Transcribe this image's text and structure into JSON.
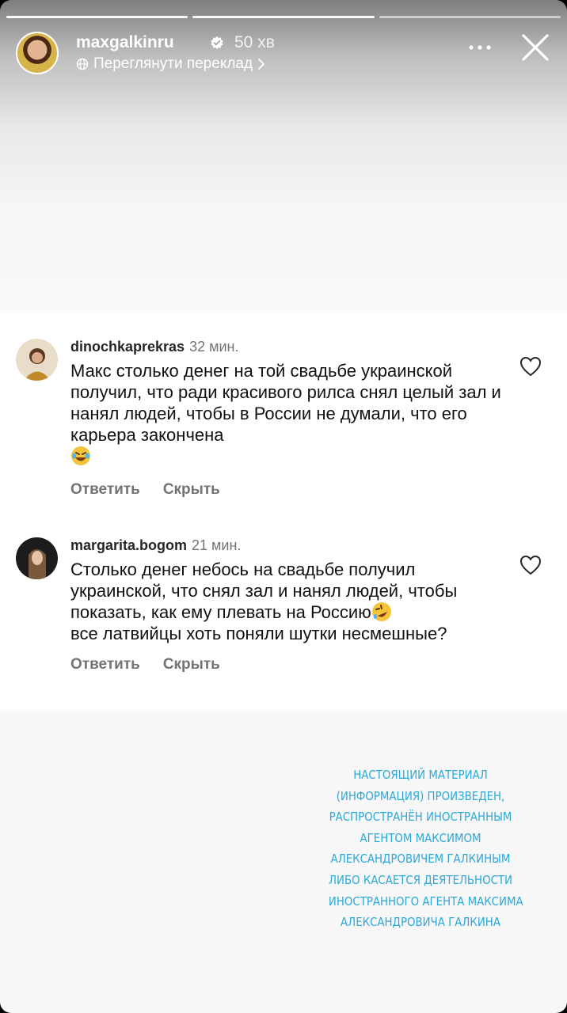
{
  "story": {
    "username": "maxgalkinru",
    "time": "50 хв",
    "translate_label": "Переглянути переклад",
    "segments": 3
  },
  "comments": [
    {
      "username": "dinochkaprekras",
      "time": "32 мин.",
      "text": "Макс столько денег на той свадьбе украинской получил, что ради красивого рилса снял целый зал и нанял людей, чтобы в России не думали, что его карьера закончена",
      "emoji": "😂",
      "reply_label": "Ответить",
      "hide_label": "Скрыть"
    },
    {
      "username": "margarita.bogom",
      "time": "21 мин.",
      "text_line_1": "Столько денег небось на свадьбе получил украинской, что снял зал и нанял людей, чтобы показать, как ему плевать на Россию",
      "emoji": "🤣",
      "text_line_2": "все латвийцы хоть поняли шутки несмешные?",
      "reply_label": "Ответить",
      "hide_label": "Скрыть"
    }
  ],
  "notice": {
    "lines": [
      "НАСТОЯЩИЙ МАТЕРИАЛ",
      "(ИНФОРМАЦИЯ) ПРОИЗВЕДЕН,",
      "РАСПРОСТРАНЁН ИНОСТРАННЫМ",
      "АГЕНТОМ МАКСИМОМ",
      "АЛЕКСАНДРОВИЧЕМ ГАЛКИНЫМ",
      "ЛИБО КАСАЕТСЯ ДЕЯТЕЛЬНОСТИ",
      "ИНОСТРАННОГО АГЕНТА МАКСИМА",
      "АЛЕКСАНДРОВИЧА ГАЛКИНА"
    ],
    "color": "#2ba8d8"
  },
  "icons": {
    "verified": "verified-badge-icon",
    "translate": "globe-icon",
    "more": "more-dots-icon",
    "close": "close-icon",
    "like": "heart-icon"
  }
}
